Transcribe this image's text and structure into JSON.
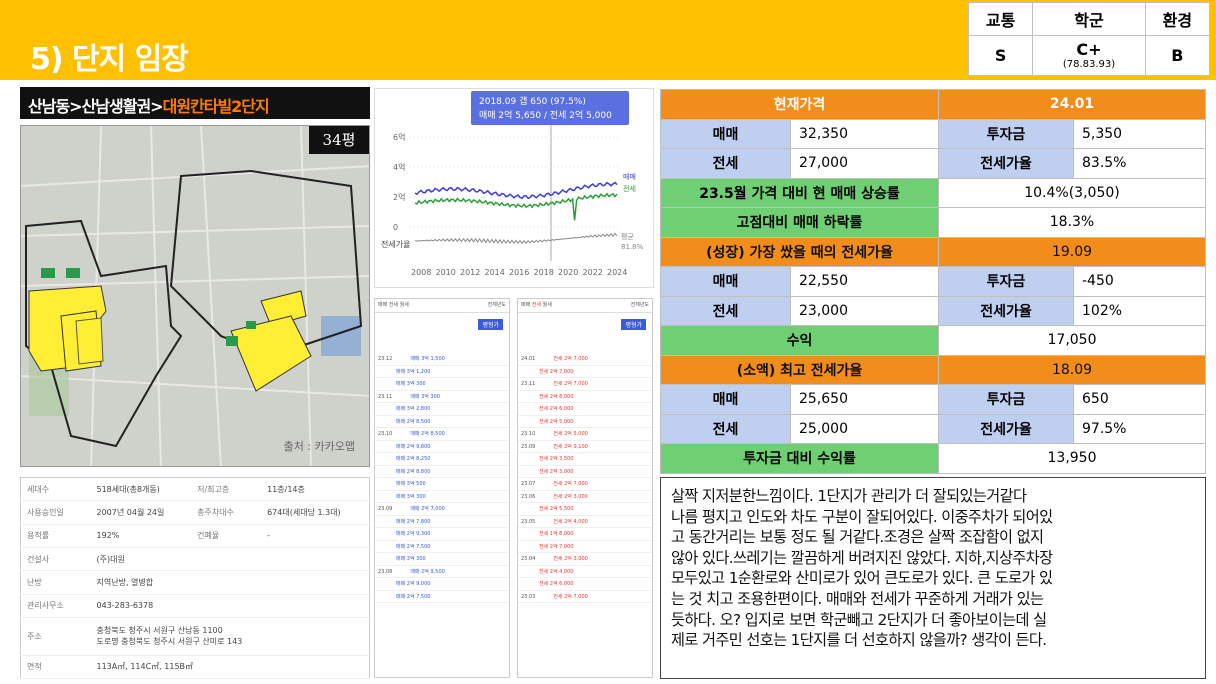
{
  "header": {
    "title": "5) 단지 임장",
    "grades": {
      "labels": [
        "교통",
        "학군",
        "환경"
      ],
      "values": [
        "S",
        "C+",
        "B"
      ],
      "school_sub": "(78.83.93)"
    }
  },
  "breadcrumb": {
    "path": "산남동>산남생활권>",
    "highlight": "대원칸타빌2단지"
  },
  "map": {
    "pyeong": "34평",
    "credit": "출처 : 카카오맵"
  },
  "info": [
    {
      "k1": "세대수",
      "v1": "518세대(총8개동)",
      "k2": "저/최고층",
      "v2": "11층/14층"
    },
    {
      "k1": "사용승인일",
      "v1": "2007년 04월 24일",
      "k2": "총주차대수",
      "v2": "674대(세대당 1.3대)"
    },
    {
      "k1": "용적률",
      "v1": "192%",
      "k2": "건폐율",
      "v2": "-"
    },
    {
      "k1": "건설사",
      "v1": "(주)대원",
      "k2": "",
      "v2": ""
    },
    {
      "k1": "난방",
      "v1": "지역난방, 열병합",
      "k2": "",
      "v2": ""
    },
    {
      "k1": "관리사무소",
      "v1": "043-283-6378",
      "k2": "",
      "v2": ""
    },
    {
      "k1": "주소",
      "v1": "충청북도 청주시 서원구 산남동 1100",
      "v1b": "도로명 충청북도 청주시 서원구 산미로 143",
      "k2": "",
      "v2": ""
    },
    {
      "k1": "면적",
      "v1": "113A㎡, 114C㎡, 115B㎡",
      "k2": "",
      "v2": ""
    }
  ],
  "chart": {
    "tooltip_line1": "2018.09 갭 650 (97.5%)",
    "tooltip_line2": "매매 2억 5,650 / 전세 2억 5,000",
    "y_ticks": [
      "6억",
      "4억",
      "2억",
      "0"
    ],
    "x_ticks": [
      "2008",
      "2010",
      "2012",
      "2014",
      "2016",
      "2018",
      "2020",
      "2022",
      "2024"
    ],
    "legend_sale": "매매",
    "legend_jeonse": "전세",
    "ratio_label": "전세가율",
    "avg_label": "평균",
    "avg_value": "81.8%",
    "colors": {
      "sale": "#3b3bdc",
      "jeonse": "#2e9e3a",
      "ratio": "#888888"
    }
  },
  "list1": {
    "tabs": [
      "매매",
      "전세",
      "월세"
    ],
    "filter": "전체년도",
    "btn": "평형가",
    "rows": [
      "23.12",
      "",
      "",
      "23.11",
      "",
      "",
      "23.10",
      "",
      "",
      "",
      "",
      "",
      "23.09",
      "",
      "",
      "",
      "",
      "23.08",
      "",
      "",
      "",
      "",
      "23.07",
      "",
      "",
      "",
      "23.06",
      "",
      "23.05"
    ],
    "prices": [
      "매매 3억 1,500",
      "매매 3억 1,200",
      "매매 3억 300",
      "매매 3억 300",
      "매매 3억 2,800",
      "매매 2억 8,500",
      "매매 2억 8,500",
      "매매 2억 9,800",
      "매매 2억 8,250",
      "매매 2억 8,800",
      "매매 3억 500",
      "매매 3억 300",
      "매매 2억 7,000",
      "매매 2억 7,800",
      "매매 2억 9,300",
      "매매 2억 7,500",
      "매매 3억 300",
      "매매 2억 9,500",
      "매매 2억 9,000",
      "매매 2억 7,500"
    ]
  },
  "list2": {
    "tabs": [
      "매매",
      "전세",
      "월세"
    ],
    "filter": "전체년도",
    "btn": "평형가",
    "rows": [
      "24.01",
      "",
      "23.11",
      "",
      "",
      "",
      "23.10",
      "23.09",
      "",
      "",
      "23.07",
      "23.06",
      "",
      "23.05",
      "",
      "",
      "23.04",
      "",
      "",
      "23.03",
      "",
      "",
      "23.02"
    ],
    "prices": [
      "전세 2억 7,000",
      "전세 2억 7,000",
      "전세 2억 7,000",
      "전세 2억 8,000",
      "전세 2억 6,000",
      "전세 2억 5,000",
      "전세 2억 5,000",
      "전세 2억 9,100",
      "전세 2억 3,500",
      "전세 2억 3,000",
      "전세 2억 7,000",
      "전세 2억 3,000",
      "전세 2억 5,500",
      "전세 2억 4,000",
      "전세 1억 8,000",
      "전세 2억 7,000",
      "전세 2억 3,000",
      "전세 2억 4,000",
      "전세 2억 6,000",
      "전세 2억 7,000"
    ]
  },
  "price_table": {
    "current_label": "현재가격",
    "current_date": "24.01",
    "sale_label": "매매",
    "sale": "32,350",
    "invest_label": "투자금",
    "invest": "5,350",
    "jeonse_label": "전세",
    "jeonse": "27,000",
    "ratio_label": "전세가율",
    "ratio": "83.5%",
    "rise_label": "23.5월 가격 대비 현 매매 상승률",
    "rise": "10.4%(3,050)",
    "drop_label": "고점대비 매매 하락률",
    "drop": "18.3%",
    "growth_label": "(성장) 가장 쌌을 때의 전세가율",
    "growth_date": "19.09",
    "g_sale": "22,550",
    "g_invest": "-450",
    "g_jeonse": "23,000",
    "g_ratio": "102%",
    "profit_label": "수익",
    "profit": "17,050",
    "low_label": "(소액) 최고 전세가율",
    "low_date": "18.09",
    "l_sale": "25,650",
    "l_invest": "650",
    "l_jeonse": "25,000",
    "l_ratio": "97.5%",
    "roi_label": "투자금 대비 수익률",
    "roi": "13,950"
  },
  "memo": {
    "lines": [
      "살짝 지저분한느낌이다. 1단지가 관리가 더 잘되있는거같다",
      "나름 평지고 인도와 차도 구분이 잘되어있다. 이중주차가 되어있",
      "고 동간거리는 보통 정도 될 거같다.조경은 살짝 조잡함이 없지",
      "않아 있다.쓰레기는 깔끔하게 버려지진 않았다. 지하,지상주차장",
      "모두있고 1순환로와 산미로가 있어 큰도로가 있다. 큰 도로가 있",
      "는 것 치고 조용한편이다. 매매와 전세가 꾸준하게 거래가 있는",
      "듯하다. 오? 입지로 보면 학군빼고 2단지가 더 좋아보이는데 실",
      "제로 거주민 선호는 1단지를 더 선호하지 않을까? 생각이 든다."
    ]
  }
}
